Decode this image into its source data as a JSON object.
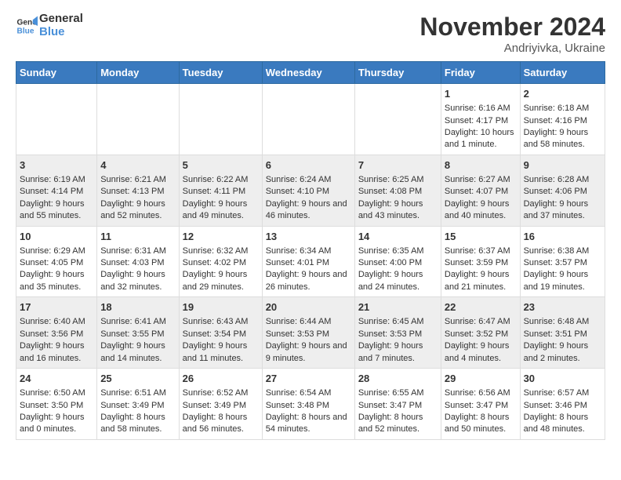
{
  "logo": {
    "line1": "General",
    "line2": "Blue"
  },
  "title": "November 2024",
  "subtitle": "Andriyivka, Ukraine",
  "weekdays": [
    "Sunday",
    "Monday",
    "Tuesday",
    "Wednesday",
    "Thursday",
    "Friday",
    "Saturday"
  ],
  "weeks": [
    {
      "days": [
        {
          "num": "",
          "content": ""
        },
        {
          "num": "",
          "content": ""
        },
        {
          "num": "",
          "content": ""
        },
        {
          "num": "",
          "content": ""
        },
        {
          "num": "",
          "content": ""
        },
        {
          "num": "1",
          "content": "Sunrise: 6:16 AM\nSunset: 4:17 PM\nDaylight: 10 hours and 1 minute."
        },
        {
          "num": "2",
          "content": "Sunrise: 6:18 AM\nSunset: 4:16 PM\nDaylight: 9 hours and 58 minutes."
        }
      ]
    },
    {
      "days": [
        {
          "num": "3",
          "content": "Sunrise: 6:19 AM\nSunset: 4:14 PM\nDaylight: 9 hours and 55 minutes."
        },
        {
          "num": "4",
          "content": "Sunrise: 6:21 AM\nSunset: 4:13 PM\nDaylight: 9 hours and 52 minutes."
        },
        {
          "num": "5",
          "content": "Sunrise: 6:22 AM\nSunset: 4:11 PM\nDaylight: 9 hours and 49 minutes."
        },
        {
          "num": "6",
          "content": "Sunrise: 6:24 AM\nSunset: 4:10 PM\nDaylight: 9 hours and 46 minutes."
        },
        {
          "num": "7",
          "content": "Sunrise: 6:25 AM\nSunset: 4:08 PM\nDaylight: 9 hours and 43 minutes."
        },
        {
          "num": "8",
          "content": "Sunrise: 6:27 AM\nSunset: 4:07 PM\nDaylight: 9 hours and 40 minutes."
        },
        {
          "num": "9",
          "content": "Sunrise: 6:28 AM\nSunset: 4:06 PM\nDaylight: 9 hours and 37 minutes."
        }
      ]
    },
    {
      "days": [
        {
          "num": "10",
          "content": "Sunrise: 6:29 AM\nSunset: 4:05 PM\nDaylight: 9 hours and 35 minutes."
        },
        {
          "num": "11",
          "content": "Sunrise: 6:31 AM\nSunset: 4:03 PM\nDaylight: 9 hours and 32 minutes."
        },
        {
          "num": "12",
          "content": "Sunrise: 6:32 AM\nSunset: 4:02 PM\nDaylight: 9 hours and 29 minutes."
        },
        {
          "num": "13",
          "content": "Sunrise: 6:34 AM\nSunset: 4:01 PM\nDaylight: 9 hours and 26 minutes."
        },
        {
          "num": "14",
          "content": "Sunrise: 6:35 AM\nSunset: 4:00 PM\nDaylight: 9 hours and 24 minutes."
        },
        {
          "num": "15",
          "content": "Sunrise: 6:37 AM\nSunset: 3:59 PM\nDaylight: 9 hours and 21 minutes."
        },
        {
          "num": "16",
          "content": "Sunrise: 6:38 AM\nSunset: 3:57 PM\nDaylight: 9 hours and 19 minutes."
        }
      ]
    },
    {
      "days": [
        {
          "num": "17",
          "content": "Sunrise: 6:40 AM\nSunset: 3:56 PM\nDaylight: 9 hours and 16 minutes."
        },
        {
          "num": "18",
          "content": "Sunrise: 6:41 AM\nSunset: 3:55 PM\nDaylight: 9 hours and 14 minutes."
        },
        {
          "num": "19",
          "content": "Sunrise: 6:43 AM\nSunset: 3:54 PM\nDaylight: 9 hours and 11 minutes."
        },
        {
          "num": "20",
          "content": "Sunrise: 6:44 AM\nSunset: 3:53 PM\nDaylight: 9 hours and 9 minutes."
        },
        {
          "num": "21",
          "content": "Sunrise: 6:45 AM\nSunset: 3:53 PM\nDaylight: 9 hours and 7 minutes."
        },
        {
          "num": "22",
          "content": "Sunrise: 6:47 AM\nSunset: 3:52 PM\nDaylight: 9 hours and 4 minutes."
        },
        {
          "num": "23",
          "content": "Sunrise: 6:48 AM\nSunset: 3:51 PM\nDaylight: 9 hours and 2 minutes."
        }
      ]
    },
    {
      "days": [
        {
          "num": "24",
          "content": "Sunrise: 6:50 AM\nSunset: 3:50 PM\nDaylight: 9 hours and 0 minutes."
        },
        {
          "num": "25",
          "content": "Sunrise: 6:51 AM\nSunset: 3:49 PM\nDaylight: 8 hours and 58 minutes."
        },
        {
          "num": "26",
          "content": "Sunrise: 6:52 AM\nSunset: 3:49 PM\nDaylight: 8 hours and 56 minutes."
        },
        {
          "num": "27",
          "content": "Sunrise: 6:54 AM\nSunset: 3:48 PM\nDaylight: 8 hours and 54 minutes."
        },
        {
          "num": "28",
          "content": "Sunrise: 6:55 AM\nSunset: 3:47 PM\nDaylight: 8 hours and 52 minutes."
        },
        {
          "num": "29",
          "content": "Sunrise: 6:56 AM\nSunset: 3:47 PM\nDaylight: 8 hours and 50 minutes."
        },
        {
          "num": "30",
          "content": "Sunrise: 6:57 AM\nSunset: 3:46 PM\nDaylight: 8 hours and 48 minutes."
        }
      ]
    }
  ]
}
